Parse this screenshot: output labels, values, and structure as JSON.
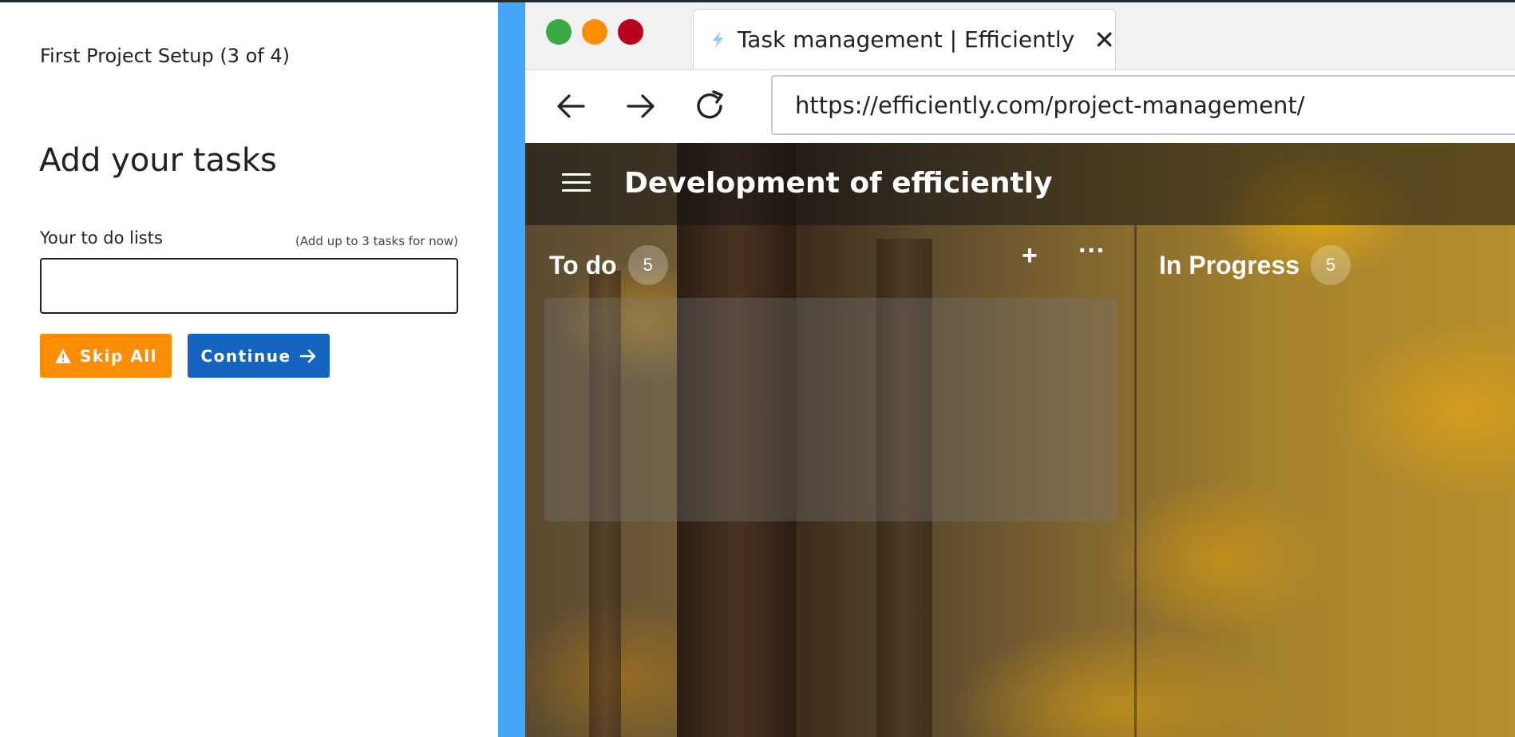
{
  "setup": {
    "step": "First Project Setup (3 of 4)",
    "heading": "Add your tasks",
    "field_label": "Your to do lists",
    "field_hint": "(Add up to 3 tasks for now)",
    "field_value": "",
    "skip_label": "Skip All",
    "continue_label": "Continue",
    "skip_color": "#ff8c05",
    "continue_color": "#1565c0"
  },
  "browser": {
    "tab_title": "Task management | Efficiently",
    "url": "https://efficiently.com/project-management/"
  },
  "app": {
    "project_title": "Development of efficiently",
    "columns": [
      {
        "title": "To do",
        "count": "5"
      },
      {
        "title": "In Progress",
        "count": "5"
      }
    ]
  },
  "icons": {
    "traffic_lights": [
      "green",
      "orange",
      "red"
    ],
    "tab_icon": "lightning-icon",
    "nav": [
      "back-arrow-icon",
      "forward-arrow-icon",
      "reload-icon"
    ]
  }
}
